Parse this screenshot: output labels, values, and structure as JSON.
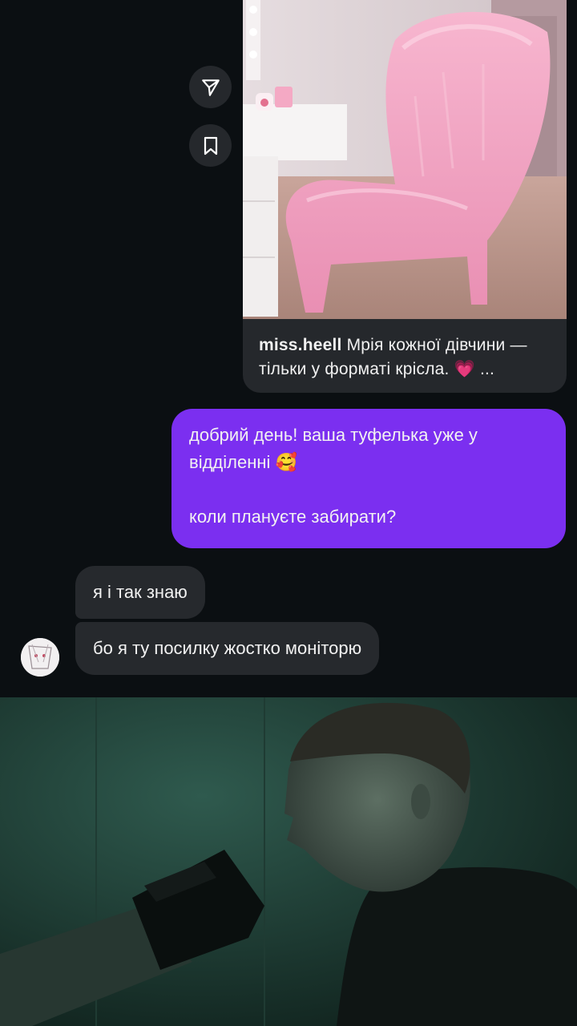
{
  "shared_post": {
    "author": "miss.heell",
    "caption": "Мрія кожної дівчини — тільки у форматі крісла. 💗 ..."
  },
  "side_actions": {
    "share_icon": "send-icon",
    "save_icon": "bookmark-icon"
  },
  "messages": {
    "outgoing": {
      "line1": "добрий день! ваша туфелька уже у відділенні 🥰",
      "line2": "коли плануєте забирати?"
    },
    "incoming": [
      "я і так знаю",
      "бо я ту посилку жостко моніторю"
    ]
  },
  "colors": {
    "background": "#0b0f12",
    "outgoing_bubble": "#7b2ff0",
    "incoming_bubble": "#26292d"
  }
}
